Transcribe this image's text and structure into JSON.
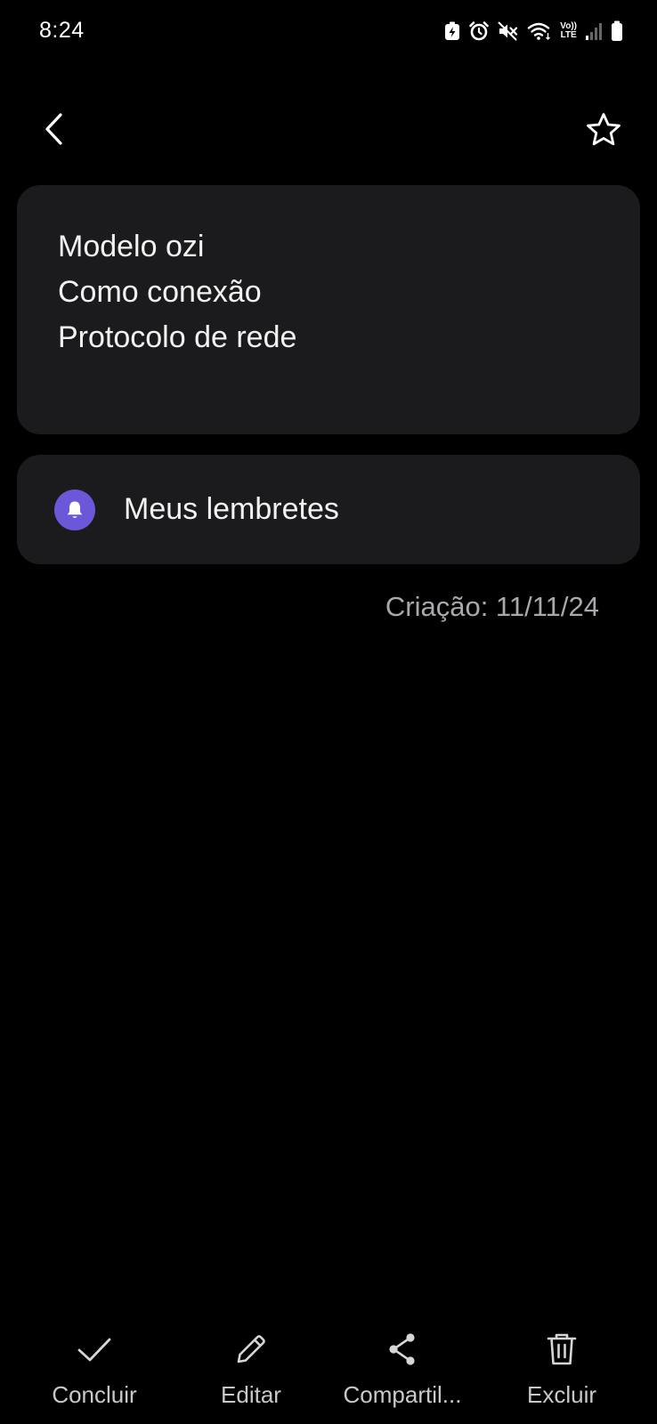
{
  "status_bar": {
    "time": "8:24",
    "network_label_top": "Vo))",
    "network_label_bottom": "LTE",
    "icons": [
      "battery-saver-icon",
      "alarm-icon",
      "mute-icon",
      "wifi-icon",
      "volte-icon",
      "signal-icon",
      "battery-icon"
    ]
  },
  "header": {
    "back_icon": "back-chevron-icon",
    "favorite_icon": "star-outline-icon"
  },
  "note": {
    "lines": [
      "Modelo ozi",
      "Como conexão",
      "Protocolo de rede"
    ]
  },
  "reminder": {
    "icon": "bell-icon",
    "icon_color": "#6a58d8",
    "label": "Meus lembretes"
  },
  "created": "Criação: 11/11/24",
  "toolbar": {
    "conclude": "Concluir",
    "edit": "Editar",
    "share": "Compartil...",
    "delete": "Excluir"
  },
  "colors": {
    "background": "#000000",
    "card": "#1b1b1d",
    "text": "#f2f2f2",
    "secondary_text": "#a9a9ad"
  }
}
